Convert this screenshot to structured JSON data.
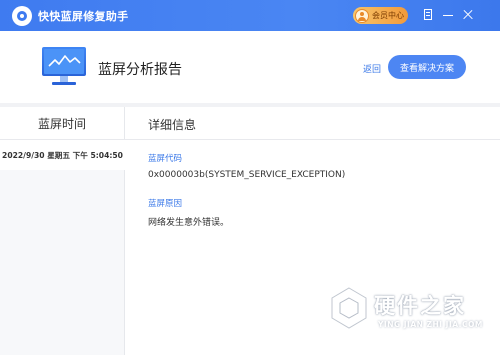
{
  "app": {
    "title": "快快蓝屏修复助手",
    "vip_label": "会员中心"
  },
  "header": {
    "title": "蓝屏分析报告",
    "back_label": "返回",
    "solution_label": "查看解决方案"
  },
  "columns": {
    "left_title": "蓝屏时间",
    "right_title": "详细信息"
  },
  "records": [
    {
      "time": "2022/9/30 星期五 下午 5:04:50"
    }
  ],
  "details": {
    "code_label": "蓝屏代码",
    "code_value": "0x0000003b(SYSTEM_SERVICE_EXCEPTION)",
    "reason_label": "蓝屏原因",
    "reason_value": "网络发生意外错误。"
  },
  "watermark": {
    "title": "硬件之家",
    "subtitle": "YING JIAN ZHI JIA.COM"
  },
  "colors": {
    "titlebar": "#4a86f3",
    "accent": "#3a78e8",
    "button": "#4d86f3",
    "vip": "#f29a3b"
  }
}
